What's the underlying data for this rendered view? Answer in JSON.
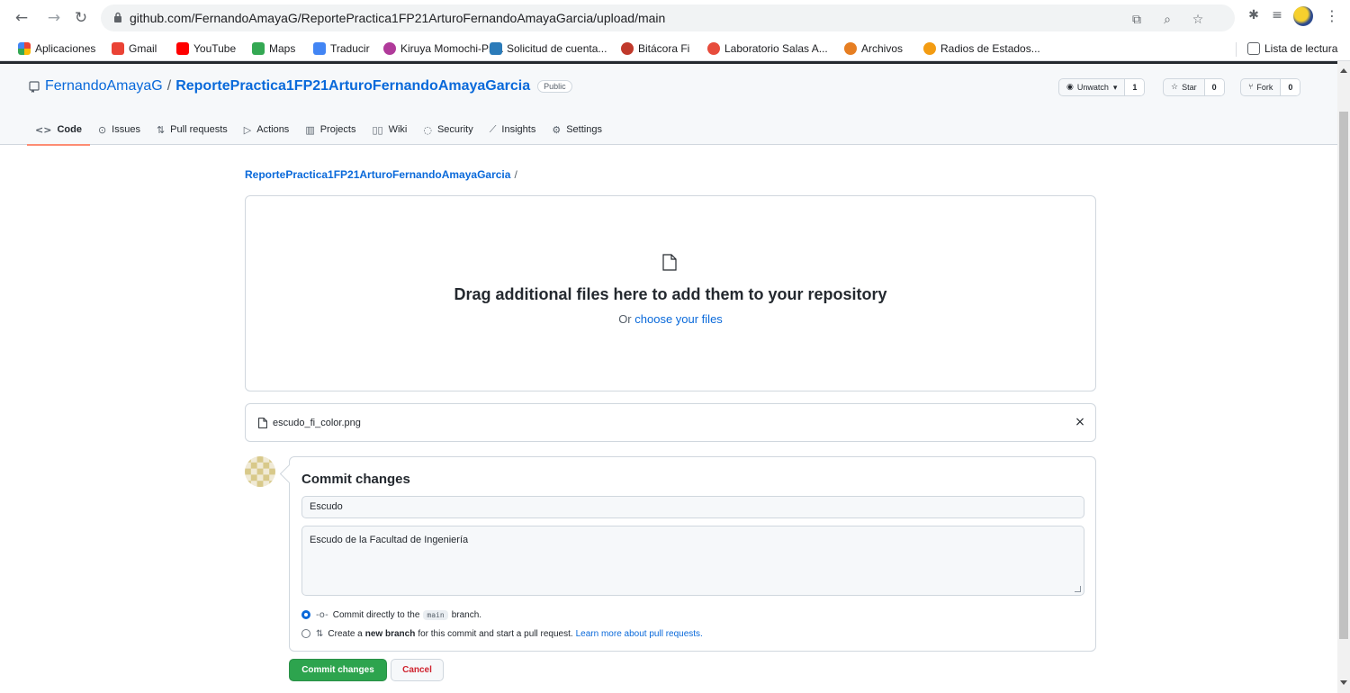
{
  "browser": {
    "url": "github.com/FernandoAmayaG/ReportePractica1FP21ArturoFernandoAmayaGarcia/upload/main",
    "bookmarks": [
      {
        "label": "Aplicaciones",
        "icon": "apps-grid-icon",
        "color": "#4285f4"
      },
      {
        "label": "Gmail",
        "icon": "gmail-icon",
        "color": "#ea4335"
      },
      {
        "label": "YouTube",
        "icon": "youtube-icon",
        "color": "#ff0000"
      },
      {
        "label": "Maps",
        "icon": "maps-icon",
        "color": "#34a853"
      },
      {
        "label": "Traducir",
        "icon": "translate-icon",
        "color": "#4285f4"
      },
      {
        "label": "Kiruya Momochi-Pri...",
        "icon": "kiruya-icon",
        "color": "#b03a9a"
      },
      {
        "label": "Solicitud de cuenta...",
        "icon": "solicitud-icon",
        "color": "#2b7bb9"
      },
      {
        "label": "Bitácora Fi",
        "icon": "bitacora-icon",
        "color": "#c0392b"
      },
      {
        "label": "Laboratorio Salas A...",
        "icon": "laboratorio-icon",
        "color": "#e74c3c"
      },
      {
        "label": "Archivos",
        "icon": "archivos-icon",
        "color": "#e67e22"
      },
      {
        "label": "Radios de Estados...",
        "icon": "radios-icon",
        "color": "#f39c12"
      }
    ],
    "reading_list": "Lista de lectura"
  },
  "repo": {
    "owner": "FernandoAmayaG",
    "separator": "/",
    "name": "ReportePractica1FP21ArturoFernandoAmayaGarcia",
    "visibility": "Public",
    "unwatch_label": "Unwatch",
    "unwatch_count": "1",
    "star_label": "Star",
    "star_count": "0",
    "fork_label": "Fork",
    "fork_count": "0"
  },
  "tabs": [
    {
      "label": "Code",
      "icon": "code-icon",
      "glyph": "<>"
    },
    {
      "label": "Issues",
      "icon": "issues-icon",
      "glyph": "⊙"
    },
    {
      "label": "Pull requests",
      "icon": "pull-request-icon",
      "glyph": "⇅"
    },
    {
      "label": "Actions",
      "icon": "actions-icon",
      "glyph": "▷"
    },
    {
      "label": "Projects",
      "icon": "projects-icon",
      "glyph": "▥"
    },
    {
      "label": "Wiki",
      "icon": "wiki-icon",
      "glyph": "▯▯"
    },
    {
      "label": "Security",
      "icon": "security-icon",
      "glyph": "◌"
    },
    {
      "label": "Insights",
      "icon": "insights-icon",
      "glyph": "⟋"
    },
    {
      "label": "Settings",
      "icon": "settings-icon",
      "glyph": "⚙"
    }
  ],
  "upload": {
    "breadcrumb_repo": "ReportePractica1FP21ArturoFernandoAmayaGarcia",
    "breadcrumb_sep": "/",
    "drop_title": "Drag additional files here to add them to your repository",
    "drop_or": "Or ",
    "drop_link": "choose your files",
    "file_name": "escudo_fi_color.png",
    "remove_glyph": "×"
  },
  "commit": {
    "title": "Commit changes",
    "summary": "Escudo",
    "description": "Escudo de la Facultad de Ingeniería",
    "direct_pre": "Commit directly to the",
    "branch": "main",
    "direct_post": "branch.",
    "new_pre": "Create a",
    "new_bold": "new branch",
    "new_post": "for this commit and start a pull request.",
    "learn_more": "Learn more about pull requests.",
    "commit_button": "Commit changes",
    "cancel_button": "Cancel"
  },
  "colors": {
    "link": "#0969da",
    "primary_button": "#2da44e",
    "danger_text": "#cf222e",
    "active_tab_underline": "#fd8c73"
  }
}
